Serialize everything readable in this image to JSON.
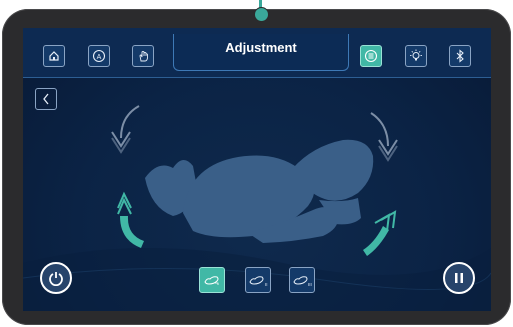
{
  "header": {
    "title": "Adjustment"
  },
  "toolbar_left": [
    {
      "icon": "home-icon"
    },
    {
      "icon": "auto-mode-icon",
      "glyph": "A"
    },
    {
      "icon": "hand-massage-icon"
    }
  ],
  "toolbar_right": [
    {
      "icon": "menu-icon",
      "active": true
    },
    {
      "icon": "light-bulb-icon"
    },
    {
      "icon": "bluetooth-icon"
    }
  ],
  "modes": [
    {
      "icon": "zero-gravity-mode-icon",
      "active": true
    },
    {
      "icon": "recline-mode-2-icon",
      "suffix": "II"
    },
    {
      "icon": "recline-mode-3-icon",
      "suffix": "III"
    }
  ],
  "colors": {
    "accent": "#41b8a6",
    "screen_bg": "#0b2345",
    "chair": "#3a5f88"
  }
}
